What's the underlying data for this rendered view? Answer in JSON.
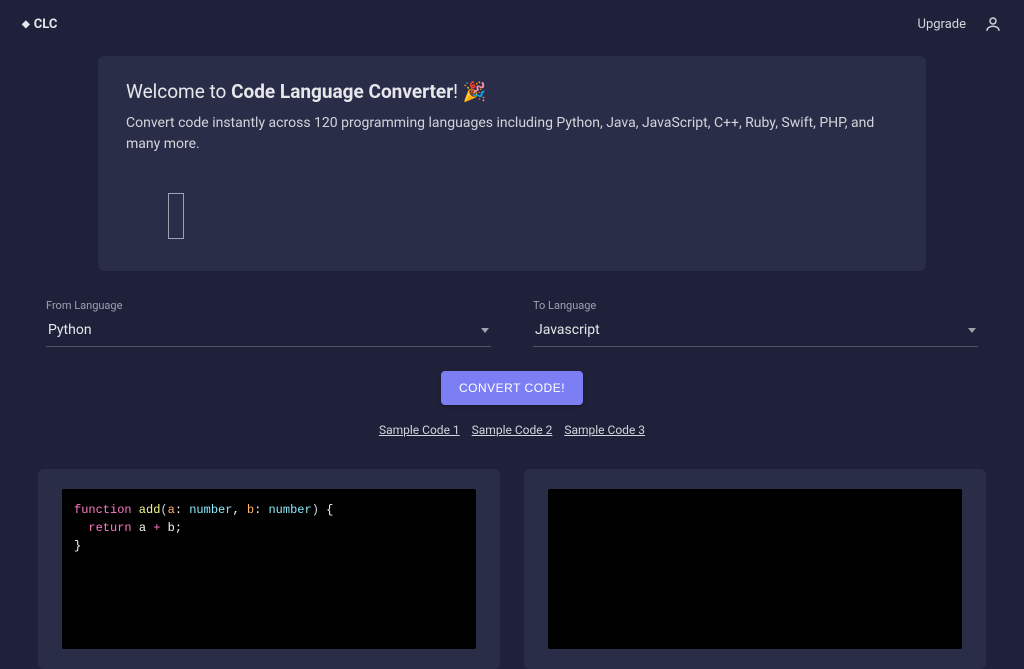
{
  "topbar": {
    "brand": "CLC",
    "upgrade": "Upgrade"
  },
  "hero": {
    "welcome_prefix": "Welcome to ",
    "title_bold": "Code Language Converter",
    "welcome_suffix": "! 🎉",
    "subtitle": "Convert code instantly across 120 programming languages including Python, Java, JavaScript, C++, Ruby, Swift, PHP, and many more."
  },
  "selectors": {
    "from_label": "From Language",
    "from_value": "Python",
    "to_label": "To Language",
    "to_value": "Javascript"
  },
  "actions": {
    "convert": "CONVERT CODE!"
  },
  "samples": [
    "Sample Code 1",
    "Sample Code 2",
    "Sample Code 3"
  ],
  "code": {
    "tokens": {
      "kw_function": "function",
      "fn_name": " add",
      "open_paren": "(",
      "p1": "a",
      "colon1": ": ",
      "t1": "number",
      "comma": ", ",
      "p2": "b",
      "colon2": ": ",
      "t2": "number",
      "close_paren": ")",
      "brace_open": " {",
      "indent": "  ",
      "kw_return": "return",
      "space": " ",
      "v1": "a",
      "op_plus": " + ",
      "v2": "b",
      "semi": ";",
      "brace_close": "}"
    }
  }
}
